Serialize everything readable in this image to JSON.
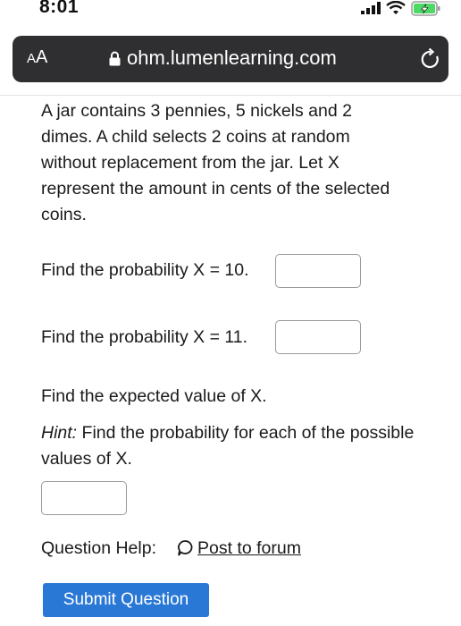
{
  "status_bar": {
    "time": "8:01"
  },
  "browser": {
    "text_size_large": "A",
    "text_size_small": "A",
    "url": "ohm.lumenlearning.com"
  },
  "question": {
    "text": "A jar contains 3 pennies, 5 nickels and 2 dimes. A child selects 2 coins at random without replacement from the jar. Let X represent the amount in cents of the selected coins.",
    "part1_label": "Find the probability X = 10.",
    "part1_value": "",
    "part2_label": "Find the probability X = 11.",
    "part2_value": "",
    "part3_label": "Find the expected value of X.",
    "hint_prefix": "Hint:",
    "hint_text": " Find the probability for each of the possible values of X.",
    "part3_value": ""
  },
  "help": {
    "label": "Question Help:",
    "link": "Post to forum"
  },
  "submit": {
    "label": "Submit Question"
  },
  "colors": {
    "submit_bg": "#2a78d6",
    "address_bar_bg": "#2f2f31"
  }
}
